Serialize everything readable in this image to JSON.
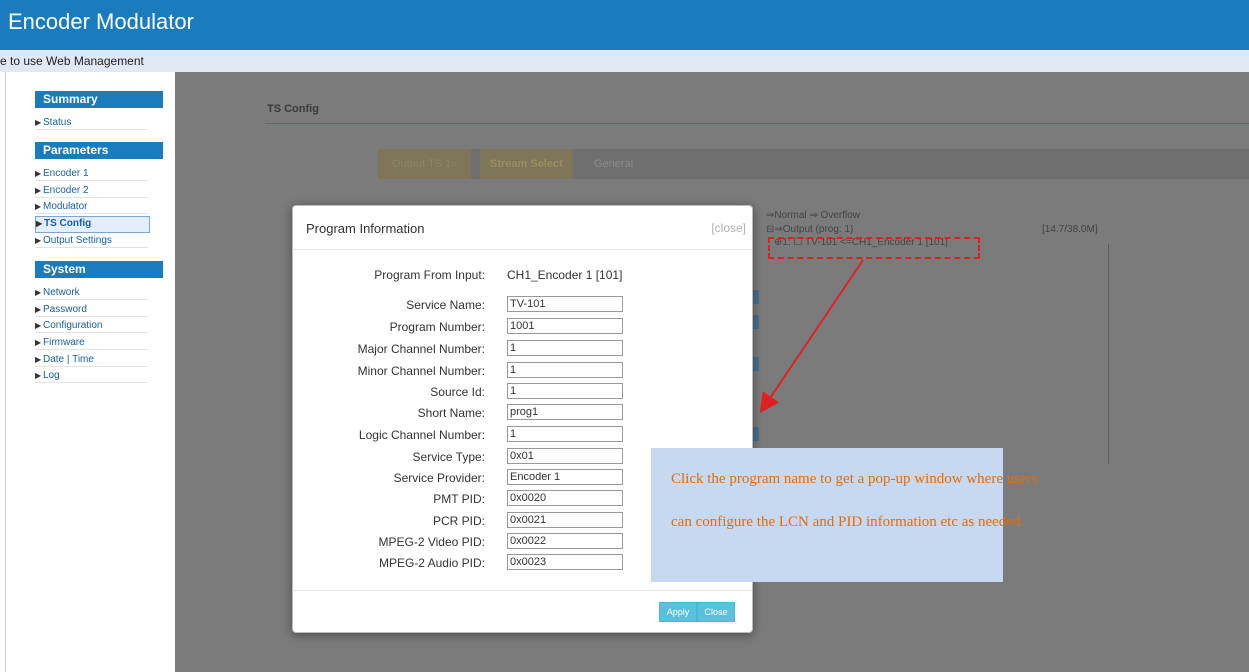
{
  "app": {
    "title": "Encoder Modulator",
    "welcome": "e to use Web Management"
  },
  "sidebar": {
    "groups": [
      {
        "title": "Summary",
        "items": [
          {
            "label": "Status"
          }
        ]
      },
      {
        "title": "Parameters",
        "items": [
          {
            "label": "Encoder 1"
          },
          {
            "label": "Encoder 2"
          },
          {
            "label": "Modulator"
          },
          {
            "label": "TS Config"
          },
          {
            "label": "Output Settings"
          }
        ]
      },
      {
        "title": "System",
        "items": [
          {
            "label": "Network"
          },
          {
            "label": "Password"
          },
          {
            "label": "Configuration"
          },
          {
            "label": "Firmware"
          },
          {
            "label": "Date | Time"
          },
          {
            "label": "Log"
          }
        ]
      }
    ],
    "active": "TS Config"
  },
  "main": {
    "title": "TS Config",
    "tabs": [
      {
        "label": "Output TS 1»"
      },
      {
        "label": "Stream Select"
      },
      {
        "label": "General"
      }
    ],
    "tree": {
      "legend": "⇒Normal  ⇒ Overflow",
      "output": "⊟⇒Output (prog: 1)",
      "bitrate": "[14.7/38.0M]",
      "program": "⊕1: ☐ TV-101 <=CH1_Encoder 1 [101]"
    }
  },
  "modal": {
    "title": "Program Information",
    "close": "[close]",
    "from_input": {
      "label": "Program From Input:",
      "value": "CH1_Encoder 1 [101]"
    },
    "fields": [
      {
        "label": "Service Name:",
        "value": "TV-101"
      },
      {
        "label": "Program Number:",
        "value": "1001"
      },
      {
        "label": "Major Channel Number:",
        "value": "1"
      },
      {
        "label": "Minor Channel Number:",
        "value": "1"
      },
      {
        "label": "Source Id:",
        "value": "1"
      },
      {
        "label": "Short Name:",
        "value": "prog1"
      },
      {
        "label": "Logic Channel Number:",
        "value": "1"
      },
      {
        "label": "Service Type:",
        "value": "0x01"
      },
      {
        "label": "Service Provider:",
        "value": "Encoder 1"
      },
      {
        "label": "PMT PID:",
        "value": "0x0020"
      },
      {
        "label": "PCR PID:",
        "value": "0x0021"
      },
      {
        "label": "MPEG-2 Video PID:",
        "value": "0x0022"
      },
      {
        "label": "MPEG-2 Audio PID:",
        "value": "0x0023"
      }
    ],
    "apply": "Apply",
    "closeBtn": "Close"
  },
  "callout": {
    "line1": "Click the program name to get a pop-up window where users",
    "line2": "can configure the LCN and PID information etc as needed."
  },
  "colors": {
    "brand": "#1a7bbd",
    "overlay": "#7b7b7b",
    "annotation": "#e36c0a",
    "highlight": "#e02020"
  }
}
